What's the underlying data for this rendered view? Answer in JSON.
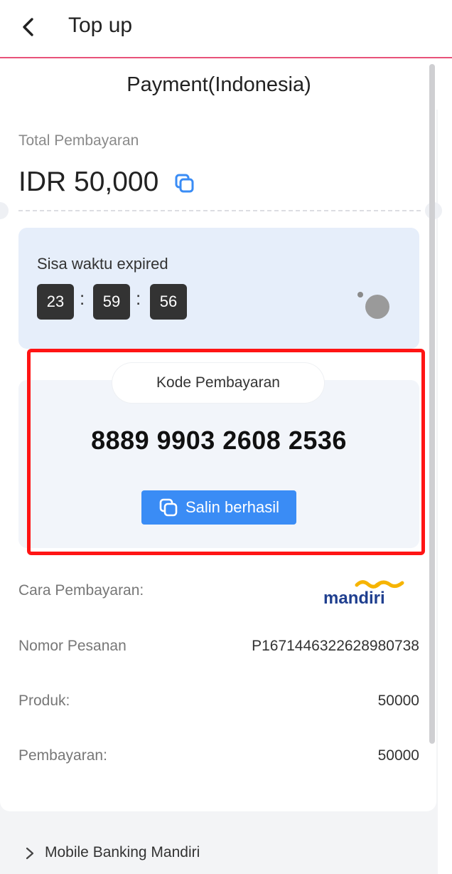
{
  "header": {
    "back_icon": "chevron-left-icon",
    "title": "Top up"
  },
  "payment": {
    "section_title": "Payment(Indonesia)",
    "total_label": "Total Pembayaran",
    "total_amount": "IDR 50,000",
    "copy_icon": "copy-icon"
  },
  "timer": {
    "label": "Sisa waktu expired",
    "hours": "23",
    "minutes": "59",
    "seconds": "56",
    "separator": ":"
  },
  "payment_code": {
    "pill_label": "Kode Pembayaran",
    "code": "8889 9903 2608 2536",
    "copy_button_label": "Salin berhasil",
    "copy_button_color": "#3a8cf5"
  },
  "details": {
    "method_label": "Cara Pembayaran:",
    "method_logo_text": "mandiri",
    "order_label": "Nomor Pesanan",
    "order_value": "P1671446322628980738",
    "product_label": "Produk:",
    "product_value": "50000",
    "payment_label": "Pembayaran:",
    "payment_value": "50000"
  },
  "instructions": {
    "item_label": "Mobile Banking Mandiri",
    "chevron_icon": "chevron-right-icon"
  },
  "colors": {
    "accent_line": "#e8527a",
    "highlight": "#ff1414",
    "timer_bg": "#e6eefa",
    "mandiri_blue": "#1f3f8f",
    "mandiri_gold": "#f6b400"
  }
}
